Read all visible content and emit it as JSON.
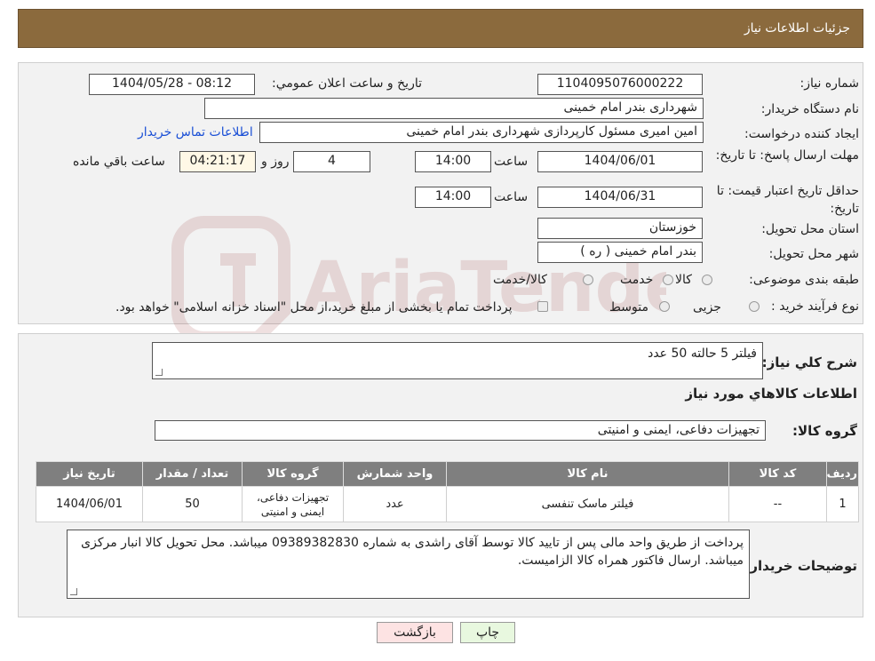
{
  "header": {
    "title": "جزئیات اطلاعات نیاز"
  },
  "form": {
    "need_number_label": "شماره نیاز:",
    "need_number": "1104095076000222",
    "announce_label": "تاریخ و ساعت اعلان عمومي:",
    "announce_value": "1404/05/28 - 08:12",
    "buyer_org_label": "نام دستگاه خریدار:",
    "buyer_org": "شهرداری بندر امام خمینی",
    "creator_label": "ایجاد کننده درخواست:",
    "creator": "امین امیری مسئول کارپردازی شهرداری بندر امام خمینی",
    "contact_link": "اطلاعات تماس خریدار",
    "deadline_label": "مهلت ارسال پاسخ: تا تاریخ:",
    "deadline_date": "1404/06/01",
    "time_label": "ساعت",
    "deadline_time": "14:00",
    "days_value": "4",
    "days_label": "روز و",
    "remaining_value": "04:21:17",
    "remaining_label": "ساعت باقي مانده",
    "validity_label": "حداقل تاریخ اعتبار قیمت: تا تاریخ:",
    "validity_date": "1404/06/31",
    "validity_time": "14:00",
    "province_label": "استان محل تحویل:",
    "province": "خوزستان",
    "city_label": "شهر محل تحویل:",
    "city": "بندر امام خمینی ( ره )",
    "category_label": "طبقه بندی موضوعی:",
    "category_options": [
      "کالا",
      "خدمت",
      "کالا/خدمت"
    ],
    "process_label": "نوع فرآیند خرید :",
    "process_options": [
      "جزیی",
      "متوسط"
    ],
    "process_note": "پرداخت تمام یا بخشی از مبلغ خرید،از محل \"اسناد خزانه اسلامی\" خواهد بود."
  },
  "desc": {
    "label": "شرح کلي نیاز:",
    "value": "فیلتر 5 حالته  50 عدد"
  },
  "goods": {
    "section_title": "اطلاعات کالاهاي مورد نیاز",
    "group_label": "گروه کالا:",
    "group_value": "تجهیزات دفاعی، ایمنی و امنیتی"
  },
  "table": {
    "headers": [
      "ردیف",
      "کد کالا",
      "نام کالا",
      "واحد شمارش",
      "گروه کالا",
      "تعداد / مقدار",
      "تاریخ نیاز"
    ],
    "rows": [
      [
        "1",
        "--",
        "فیلتر ماسک تنفسی",
        "عدد",
        "تجهیزات دفاعی، ایمنی و امنیتی",
        "50",
        "1404/06/01"
      ]
    ]
  },
  "buyer_notes": {
    "label": "توضیحات خریدار:",
    "value": "پرداخت از طریق واحد مالی پس از تایید کالا توسط آقای راشدی به شماره 09389382830 میباشد. محل تحویل کالا انبار مرکزی  میباشد. ارسال فاکتور همراه کالا الزامیست."
  },
  "buttons": {
    "print": "چاپ",
    "back": "بازگشت"
  },
  "watermark": {
    "text": "AriaTender.neT"
  }
}
